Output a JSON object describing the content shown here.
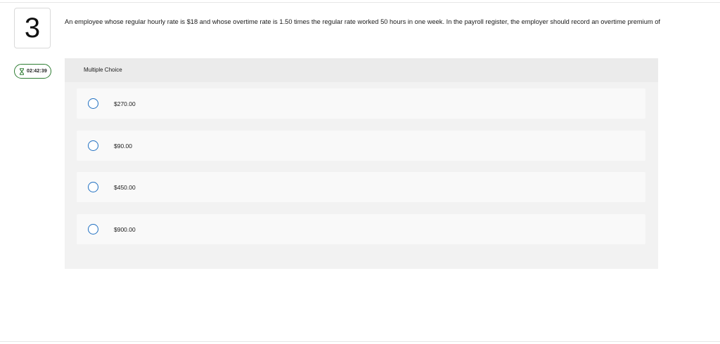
{
  "question": {
    "number": "3",
    "text": "An employee whose regular hourly rate is $18 and whose overtime rate is 1.50 times the regular rate worked 50 hours in one week. In the payroll register, the employer should record an overtime premium of"
  },
  "timer": {
    "icon": "hourglass-icon",
    "value": "02:42:39",
    "color": "#2e7d32"
  },
  "answer_panel": {
    "type_label": "Multiple Choice",
    "options": [
      {
        "label": "$270.00"
      },
      {
        "label": "$90.00"
      },
      {
        "label": "$450.00"
      },
      {
        "label": "$900.00"
      }
    ]
  },
  "colors": {
    "radio_border": "#1f6fc1",
    "panel_bg": "#f2f2f2"
  }
}
